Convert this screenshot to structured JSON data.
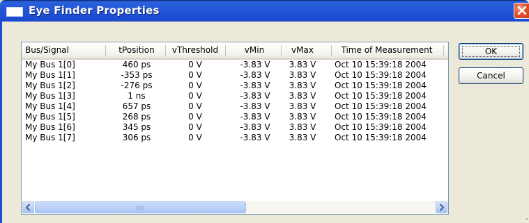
{
  "window": {
    "title": "Eye Finder Properties"
  },
  "table": {
    "columns": [
      "Bus/Signal",
      "tPosition",
      "vThreshold",
      "vMin",
      "vMax",
      "Time of Measurement"
    ],
    "rows": [
      [
        "My Bus 1[0]",
        "460 ps",
        "0 V",
        "-3.83 V",
        "3.83 V",
        "Oct 10 15:39:18 2004"
      ],
      [
        "My Bus 1[1]",
        "-353 ps",
        "0 V",
        "-3.83 V",
        "3.83 V",
        "Oct 10 15:39:18 2004"
      ],
      [
        "My Bus 1[2]",
        "-276 ps",
        "0 V",
        "-3.83 V",
        "3.83 V",
        "Oct 10 15:39:18 2004"
      ],
      [
        "My Bus 1[3]",
        "1 ns",
        "0 V",
        "-3.83 V",
        "3.83 V",
        "Oct 10 15:39:18 2004"
      ],
      [
        "My Bus 1[4]",
        "657 ps",
        "0 V",
        "-3.83 V",
        "3.83 V",
        "Oct 10 15:39:18 2004"
      ],
      [
        "My Bus 1[5]",
        "268 ps",
        "0 V",
        "-3.83 V",
        "3.83 V",
        "Oct 10 15:39:18 2004"
      ],
      [
        "My Bus 1[6]",
        "345 ps",
        "0 V",
        "-3.83 V",
        "3.83 V",
        "Oct 10 15:39:18 2004"
      ],
      [
        "My Bus 1[7]",
        "306 ps",
        "0 V",
        "-3.83 V",
        "3.83 V",
        "Oct 10 15:39:18 2004"
      ]
    ]
  },
  "buttons": {
    "ok_label": "OK",
    "cancel_label": "Cancel"
  },
  "icons": {
    "window": "window-icon",
    "close": "close-icon",
    "scroll_left": "arrow-left-icon",
    "scroll_right": "arrow-right-icon"
  },
  "colors": {
    "titlebar": "#2457d8",
    "close_button": "#e05a35",
    "dialog_bg": "#ece9d8",
    "list_border": "#7f9db9"
  }
}
